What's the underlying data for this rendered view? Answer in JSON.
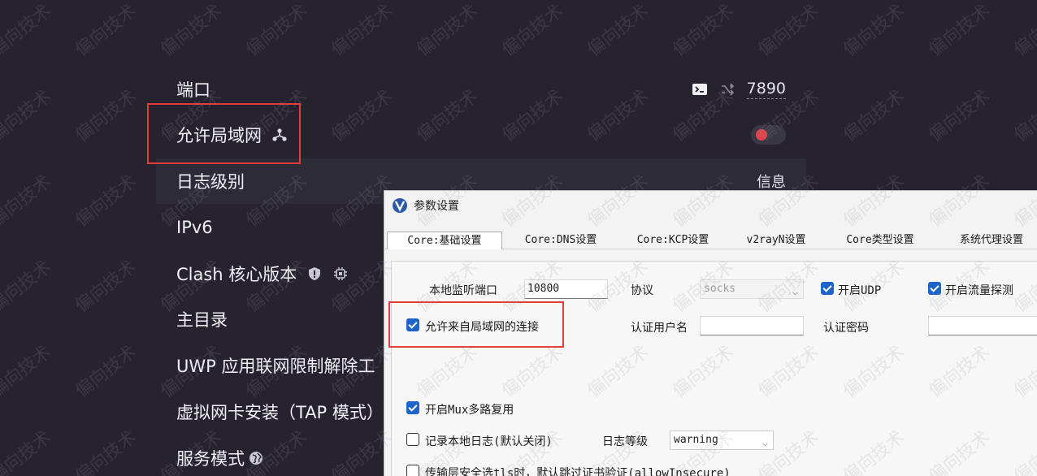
{
  "settings": {
    "rows": [
      {
        "label": "端口",
        "value": "7890"
      },
      {
        "label": "允许局域网"
      },
      {
        "label": "日志级别",
        "value": "信息"
      },
      {
        "label": "IPv6"
      },
      {
        "label": "Clash 核心版本"
      },
      {
        "label": "主目录"
      },
      {
        "label": "UWP 应用联网限制解除工"
      },
      {
        "label": "虚拟网卡安装（TAP 模式）"
      },
      {
        "label": "服务模式"
      }
    ],
    "allow_lan_enabled": false,
    "toggle_color": "#e0434b"
  },
  "dialog": {
    "title": "参数设置",
    "tabs": [
      "Core:基础设置",
      "Core:DNS设置",
      "Core:KCP设置",
      "v2rayN设置",
      "Core类型设置",
      "系统代理设置"
    ],
    "active_tab": "Core:基础设置",
    "local_port_label": "本地监听端口",
    "local_port_value": "10800",
    "protocol_label": "协议",
    "protocol_value": "socks",
    "udp_label": "开启UDP",
    "sniffing_label": "开启流量探测",
    "allow_lan_label": "允许来自局域网的连接",
    "auth_user_label": "认证用户名",
    "auth_pass_label": "认证密码",
    "mux_label": "开启Mux多路复用",
    "log_label": "记录本地日志(默认关闭)",
    "log_level_label": "日志等级",
    "log_level_value": "warning",
    "tls_label": "传输层安全选tls时，默认跳过证书验证(allowInsecure)"
  },
  "watermark": "偏向技术",
  "highlight_color": "#e33a3a"
}
